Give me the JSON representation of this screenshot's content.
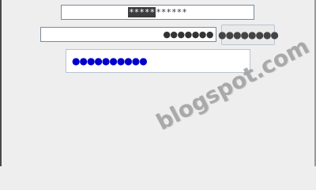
{
  "fields": {
    "password_default": {
      "selected_text": "*****",
      "rest_text": "******"
    },
    "password_dots_small": {
      "value": "●●●●●●●"
    },
    "mask_button": {
      "label": "●●●●●●●●"
    },
    "password_dots_blue": {
      "value": "●●●●●●●●●●",
      "color": "#0000cc"
    }
  },
  "watermark": {
    "text": "blogspot.com"
  }
}
